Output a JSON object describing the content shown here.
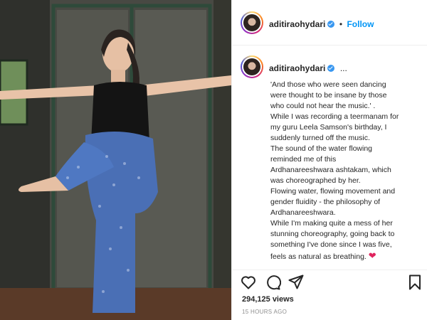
{
  "post": {
    "username": "aditiraohydari",
    "follow_label": "Follow",
    "separator": "•",
    "more_indicator": "...",
    "caption_lines": [
      "'And those who were seen dancing",
      "were thought to be insane by those",
      "who could not hear the music.' .",
      "While I was recording a teermanam for",
      "my guru Leela Samson's birthday, I",
      "suddenly turned off the music.",
      "The sound of the water flowing",
      "reminded me of this",
      "Ardhanareeshwara ashtakam, which",
      "was choreographed by her.",
      "Flowing water, flowing movement and",
      "gender fluidity - the philosophy of",
      "Ardhanareeshwara.",
      "While I'm making quite a mess of her",
      "stunning choreography, going back to",
      "something I've done since I was five,",
      "feels as natural as breathing."
    ],
    "caption_emoji": "❤",
    "views": "294,125 views",
    "timestamp": "15 HOURS AGO"
  },
  "icons": {
    "like": "heart-outline-icon",
    "comment": "comment-icon",
    "share": "paper-plane-icon",
    "save": "bookmark-icon",
    "verified": "verified-badge-icon"
  },
  "colors": {
    "follow_blue": "#0095f6",
    "verified_blue": "#3897f0",
    "text": "#262626",
    "muted": "#8e8e8e",
    "heart_red": "#e0245e"
  }
}
